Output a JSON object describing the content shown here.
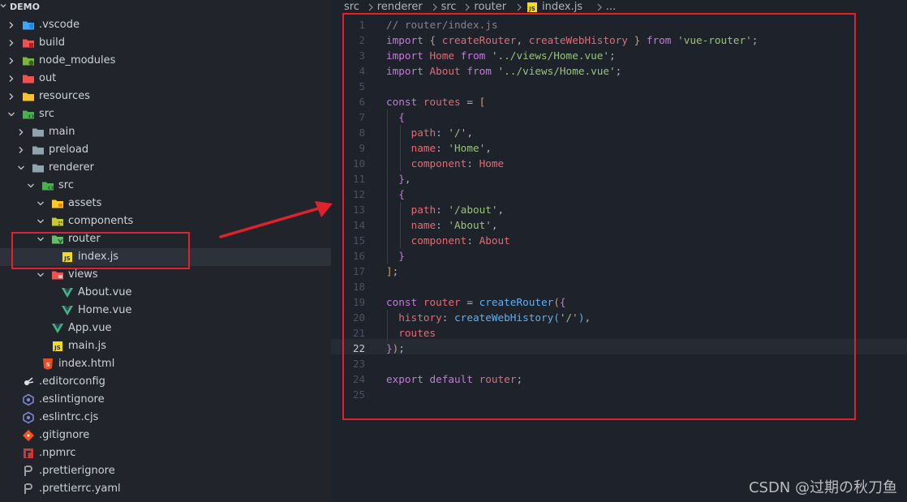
{
  "sidebar": {
    "title": "DEMO",
    "items": [
      {
        "label": ".vscode",
        "icon": "vscode-folder-icon",
        "type": "folder",
        "expanded": false,
        "depth": 0
      },
      {
        "label": "build",
        "icon": "build-folder-icon",
        "type": "folder",
        "expanded": false,
        "depth": 0
      },
      {
        "label": "node_modules",
        "icon": "node-folder-icon",
        "type": "folder",
        "expanded": false,
        "depth": 0
      },
      {
        "label": "out",
        "icon": "out-folder-icon",
        "type": "folder",
        "expanded": false,
        "depth": 0
      },
      {
        "label": "resources",
        "icon": "resources-folder-icon",
        "type": "folder",
        "expanded": false,
        "depth": 0
      },
      {
        "label": "src",
        "icon": "src-folder-icon",
        "type": "folder",
        "expanded": true,
        "depth": 0
      },
      {
        "label": "main",
        "icon": "folder-icon",
        "type": "folder",
        "expanded": false,
        "depth": 1
      },
      {
        "label": "preload",
        "icon": "folder-icon",
        "type": "folder",
        "expanded": false,
        "depth": 1
      },
      {
        "label": "renderer",
        "icon": "folder-icon",
        "type": "folder",
        "expanded": true,
        "depth": 1
      },
      {
        "label": "src",
        "icon": "src-folder-icon",
        "type": "folder",
        "expanded": true,
        "depth": 2
      },
      {
        "label": "assets",
        "icon": "assets-folder-icon",
        "type": "folder",
        "expanded": true,
        "depth": 3
      },
      {
        "label": "components",
        "icon": "components-folder-icon",
        "type": "folder",
        "expanded": true,
        "depth": 3
      },
      {
        "label": "router",
        "icon": "router-folder-icon",
        "type": "folder",
        "expanded": true,
        "depth": 3
      },
      {
        "label": "index.js",
        "icon": "js-file-icon",
        "type": "file",
        "depth": 4,
        "selected": true
      },
      {
        "label": "views",
        "icon": "views-folder-icon",
        "type": "folder",
        "expanded": true,
        "depth": 3
      },
      {
        "label": "About.vue",
        "icon": "vue-file-icon",
        "type": "file",
        "depth": 4
      },
      {
        "label": "Home.vue",
        "icon": "vue-file-icon",
        "type": "file",
        "depth": 4
      },
      {
        "label": "App.vue",
        "icon": "vue-file-icon",
        "type": "file",
        "depth": 3
      },
      {
        "label": "main.js",
        "icon": "js-file-icon",
        "type": "file",
        "depth": 3
      },
      {
        "label": "index.html",
        "icon": "html-file-icon",
        "type": "file",
        "depth": 2
      },
      {
        "label": ".editorconfig",
        "icon": "editorconfig-file-icon",
        "type": "file",
        "depth": 0
      },
      {
        "label": ".eslintignore",
        "icon": "eslint-file-icon",
        "type": "file",
        "depth": 0
      },
      {
        "label": ".eslintrc.cjs",
        "icon": "eslint-file-icon",
        "type": "file",
        "depth": 0
      },
      {
        "label": ".gitignore",
        "icon": "git-file-icon",
        "type": "file",
        "depth": 0
      },
      {
        "label": ".npmrc",
        "icon": "npm-file-icon",
        "type": "file",
        "depth": 0
      },
      {
        "label": ".prettierignore",
        "icon": "prettier-file-icon",
        "type": "file",
        "depth": 0
      },
      {
        "label": ".prettierrc.yaml",
        "icon": "prettier-file-icon",
        "type": "file",
        "depth": 0
      }
    ]
  },
  "breadcrumb": [
    "src",
    "renderer",
    "src",
    "router",
    "index.js",
    "..."
  ],
  "editor": {
    "active_line": 22,
    "lines": [
      [
        [
          "cm",
          "// router/index.js"
        ]
      ],
      [
        [
          "kw",
          "import"
        ],
        [
          "pun",
          " "
        ],
        [
          "br",
          "{"
        ],
        [
          "pun",
          " "
        ],
        [
          "var",
          "createRouter"
        ],
        [
          "pun",
          ", "
        ],
        [
          "var",
          "createWebHistory"
        ],
        [
          "pun",
          " "
        ],
        [
          "br",
          "}"
        ],
        [
          "pun",
          " "
        ],
        [
          "kw",
          "from"
        ],
        [
          "pun",
          " "
        ],
        [
          "str",
          "'vue-router'"
        ],
        [
          "pun",
          ";"
        ]
      ],
      [
        [
          "kw",
          "import"
        ],
        [
          "pun",
          " "
        ],
        [
          "var",
          "Home"
        ],
        [
          "pun",
          " "
        ],
        [
          "kw",
          "from"
        ],
        [
          "pun",
          " "
        ],
        [
          "str",
          "'../views/Home.vue'"
        ],
        [
          "pun",
          ";"
        ]
      ],
      [
        [
          "kw",
          "import"
        ],
        [
          "pun",
          " "
        ],
        [
          "var",
          "About"
        ],
        [
          "pun",
          " "
        ],
        [
          "kw",
          "from"
        ],
        [
          "pun",
          " "
        ],
        [
          "str",
          "'../views/Home.vue'"
        ],
        [
          "pun",
          ";"
        ]
      ],
      [],
      [
        [
          "kw",
          "const"
        ],
        [
          "pun",
          " "
        ],
        [
          "var",
          "routes"
        ],
        [
          "pun",
          " = "
        ],
        [
          "br",
          "["
        ]
      ],
      [
        [
          "pun",
          "  "
        ],
        [
          "br2",
          "{"
        ]
      ],
      [
        [
          "pun",
          "    "
        ],
        [
          "pr",
          "path"
        ],
        [
          "pun",
          ": "
        ],
        [
          "str",
          "'/'"
        ],
        [
          "pun",
          ","
        ]
      ],
      [
        [
          "pun",
          "    "
        ],
        [
          "pr",
          "name"
        ],
        [
          "pun",
          ": "
        ],
        [
          "str",
          "'Home'"
        ],
        [
          "pun",
          ","
        ]
      ],
      [
        [
          "pun",
          "    "
        ],
        [
          "pr",
          "component"
        ],
        [
          "pun",
          ": "
        ],
        [
          "var",
          "Home"
        ]
      ],
      [
        [
          "pun",
          "  "
        ],
        [
          "br2",
          "}"
        ],
        [
          "pun",
          ","
        ]
      ],
      [
        [
          "pun",
          "  "
        ],
        [
          "br2",
          "{"
        ]
      ],
      [
        [
          "pun",
          "    "
        ],
        [
          "pr",
          "path"
        ],
        [
          "pun",
          ": "
        ],
        [
          "str",
          "'/about'"
        ],
        [
          "pun",
          ","
        ]
      ],
      [
        [
          "pun",
          "    "
        ],
        [
          "pr",
          "name"
        ],
        [
          "pun",
          ": "
        ],
        [
          "str",
          "'About'"
        ],
        [
          "pun",
          ","
        ]
      ],
      [
        [
          "pun",
          "    "
        ],
        [
          "pr",
          "component"
        ],
        [
          "pun",
          ": "
        ],
        [
          "var",
          "About"
        ]
      ],
      [
        [
          "pun",
          "  "
        ],
        [
          "br2",
          "}"
        ]
      ],
      [
        [
          "br",
          "]"
        ],
        [
          "pun",
          ";"
        ]
      ],
      [],
      [
        [
          "kw",
          "const"
        ],
        [
          "pun",
          " "
        ],
        [
          "var",
          "router"
        ],
        [
          "pun",
          " = "
        ],
        [
          "fn",
          "createRouter"
        ],
        [
          "br",
          "("
        ],
        [
          "br2",
          "{"
        ]
      ],
      [
        [
          "pun",
          "  "
        ],
        [
          "pr",
          "history"
        ],
        [
          "pun",
          ": "
        ],
        [
          "fn",
          "createWebHistory"
        ],
        [
          "fn",
          "("
        ],
        [
          "str",
          "'/'"
        ],
        [
          "fn",
          ")"
        ],
        [
          "pun",
          ","
        ]
      ],
      [
        [
          "pun",
          "  "
        ],
        [
          "pr",
          "routes"
        ]
      ],
      [
        [
          "br2",
          "}"
        ],
        [
          "br",
          ")"
        ],
        [
          "pun",
          ";"
        ]
      ],
      [],
      [
        [
          "kw",
          "export"
        ],
        [
          "pun",
          " "
        ],
        [
          "kw",
          "default"
        ],
        [
          "pun",
          " "
        ],
        [
          "var",
          "router"
        ],
        [
          "pun",
          ";"
        ]
      ],
      []
    ]
  },
  "watermark": "CSDN @过期の秋刀鱼",
  "colors": {
    "annotation_red": "#e0222a",
    "sidebar_bg": "#21252b",
    "editor_bg": "#1e222a"
  }
}
